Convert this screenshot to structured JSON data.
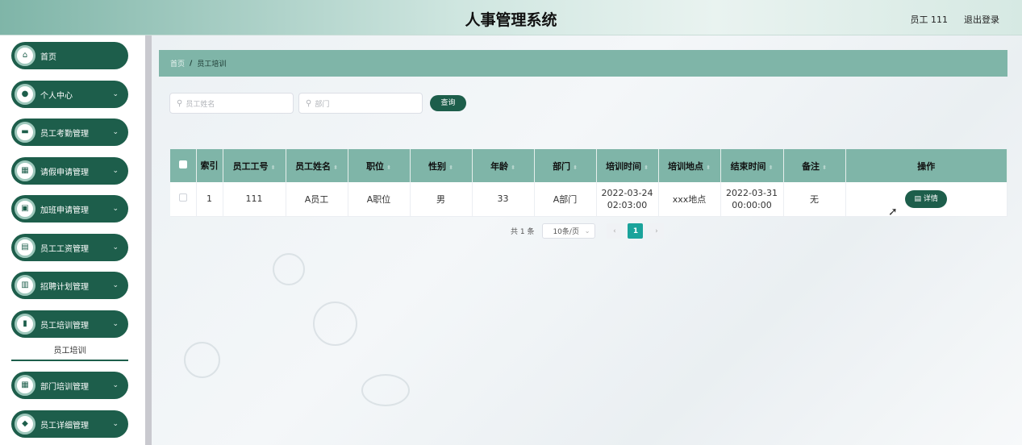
{
  "header": {
    "title": "人事管理系统",
    "user": "员工 111",
    "logout": "退出登录"
  },
  "sidebar": {
    "items": [
      {
        "label": "首页",
        "icon": "home-icon",
        "glyph": "⌂",
        "has_chevron": false
      },
      {
        "label": "个人中心",
        "icon": "user-icon",
        "glyph": "●",
        "has_chevron": true
      },
      {
        "label": "员工考勤管理",
        "icon": "monitor-icon",
        "glyph": "▬",
        "has_chevron": true
      },
      {
        "label": "请假申请管理",
        "icon": "grid-icon",
        "glyph": "▦",
        "has_chevron": true
      },
      {
        "label": "加班申请管理",
        "icon": "briefcase-icon",
        "glyph": "▣",
        "has_chevron": true
      },
      {
        "label": "员工工资管理",
        "icon": "document-icon",
        "glyph": "▤",
        "has_chevron": true
      },
      {
        "label": "招聘计划管理",
        "icon": "chart-box-icon",
        "glyph": "▥",
        "has_chevron": true
      },
      {
        "label": "员工培训管理",
        "icon": "bar-chart-icon",
        "glyph": "▮",
        "has_chevron": true
      },
      {
        "label": "部门培训管理",
        "icon": "grid-icon",
        "glyph": "▦",
        "has_chevron": true
      },
      {
        "label": "员工详细管理",
        "icon": "location-icon",
        "glyph": "◆",
        "has_chevron": true
      }
    ],
    "sub_item": "员工培训",
    "chevron": "⌄"
  },
  "breadcrumb": {
    "home": "首页",
    "sep": "/",
    "current": "员工培训"
  },
  "search": {
    "name_placeholder": "员工姓名",
    "dept_placeholder": "部门",
    "query_label": "查询"
  },
  "table": {
    "headers": [
      "索引",
      "员工工号",
      "员工姓名",
      "职位",
      "性别",
      "年龄",
      "部门",
      "培训时间",
      "培训地点",
      "结束时间",
      "备注",
      "操作"
    ],
    "rows": [
      {
        "index": "1",
        "emp_no": "111",
        "emp_name": "A员工",
        "position": "A职位",
        "gender": "男",
        "age": "33",
        "dept": "A部门",
        "train_time": "2022-03-24 02:03:00",
        "location": "xxx地点",
        "end_time": "2022-03-31 00:00:00",
        "remark": "无",
        "action": "详情"
      }
    ]
  },
  "pagination": {
    "total": "共 1 条",
    "page_size": "10条/页",
    "current_page": "1",
    "prev": "‹",
    "next": "›"
  },
  "colors": {
    "primary": "#1d5e4b",
    "accent": "#7fb5a8",
    "page_active": "#1aa39b"
  }
}
